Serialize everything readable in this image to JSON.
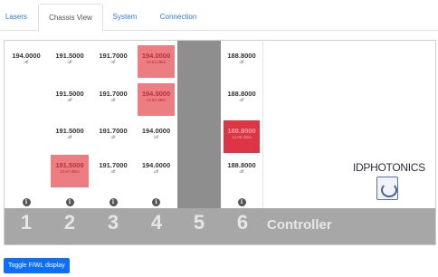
{
  "tabs": [
    {
      "label": "Lasers"
    },
    {
      "label": "Chassis View"
    },
    {
      "label": "System"
    },
    {
      "label": "Connection"
    }
  ],
  "slots": [
    {
      "number": "1",
      "cells": [
        {
          "freq": "194.0000",
          "state": "off"
        }
      ]
    },
    {
      "number": "2",
      "cells": [
        {
          "freq": "191.5000",
          "state": "off"
        },
        {
          "freq": "191.5000",
          "state": "off"
        },
        {
          "freq": "191.5000",
          "state": "off"
        },
        {
          "freq": "191.5000",
          "state": "13.87 dBm",
          "status": "on"
        }
      ]
    },
    {
      "number": "3",
      "cells": [
        {
          "freq": "191.7000",
          "state": "off"
        },
        {
          "freq": "191.7000",
          "state": "off"
        },
        {
          "freq": "191.7000",
          "state": "off"
        },
        {
          "freq": "191.7000",
          "state": "off"
        }
      ]
    },
    {
      "number": "4",
      "cells": [
        {
          "freq": "194.0000",
          "state": "13.83 dBm",
          "status": "on"
        },
        {
          "freq": "194.0000",
          "state": "13.83 dBm",
          "status": "on"
        },
        {
          "freq": "194.0000",
          "state": "off"
        },
        {
          "freq": "194.0000",
          "state": "off"
        }
      ]
    },
    {
      "number": "5",
      "cells": []
    },
    {
      "number": "6",
      "cells": [
        {
          "freq": "188.8000",
          "state": "off"
        },
        {
          "freq": "188.8000",
          "state": "off"
        },
        {
          "freq": "188.8000",
          "state": "13.85 dBm",
          "status": "alert"
        },
        {
          "freq": "188.8000",
          "state": "off"
        }
      ]
    }
  ],
  "controller_label": "Controller",
  "logo": {
    "brand": "IDPHOTONICS"
  },
  "info_glyph": "i",
  "toggle_button": "Toggle F/WL display",
  "colors": {
    "accent": "#0d6efd",
    "laser_on": "#ec7e82",
    "laser_alert": "#dc3545",
    "empty_slot": "#8e8e8e",
    "footer": "#a7a7a7"
  }
}
